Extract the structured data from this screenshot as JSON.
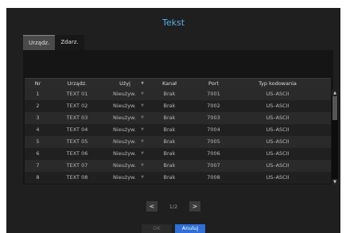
{
  "dialog": {
    "title": "Tekst",
    "tabs": [
      {
        "label": "Urządz.",
        "active": true
      },
      {
        "label": "Zdarz.",
        "active": false
      }
    ],
    "table": {
      "headers": [
        "Nr",
        "Urządz.",
        "Użyj",
        "Kanał",
        "Port",
        "Typ kodowania"
      ],
      "rows": [
        [
          "1",
          "TEXT 01",
          "Nieużyw.",
          "Brak",
          "7001",
          "US–ASCII"
        ],
        [
          "2",
          "TEXT 02",
          "Nieużyw.",
          "Brak",
          "7002",
          "US–ASCII"
        ],
        [
          "3",
          "TEXT 03",
          "Nieużyw.",
          "Brak",
          "7003",
          "US–ASCII"
        ],
        [
          "4",
          "TEXT 04",
          "Nieużyw.",
          "Brak",
          "7004",
          "US–ASCII"
        ],
        [
          "5",
          "TEXT 05",
          "Nieużyw.",
          "Brak",
          "7005",
          "US–ASCII"
        ],
        [
          "6",
          "TEXT 06",
          "Nieużyw.",
          "Brak",
          "7006",
          "US–ASCII"
        ],
        [
          "7",
          "TEXT 07",
          "Nieużyw.",
          "Brak",
          "7007",
          "US–ASCII"
        ],
        [
          "8",
          "TEXT 08",
          "Nieużyw.",
          "Brak",
          "7008",
          "US–ASCII"
        ]
      ]
    },
    "pager": {
      "prev": "<",
      "page": "1/2",
      "next": ">"
    },
    "buttons": {
      "ok": "OK",
      "cancel": "Anuluj"
    },
    "icons": {
      "dropdown": "chevron-down-icon",
      "scroll_up": "arrow-up-icon",
      "scroll_down": "arrow-down-icon"
    },
    "colors": {
      "title": "#5aaee8",
      "cancel_button": "#2f6fd6",
      "background": "#1f1f1f"
    }
  }
}
